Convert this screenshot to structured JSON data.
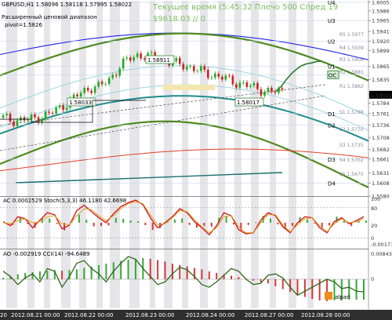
{
  "header": {
    "symbol_line": "GBPUSD,H1  1.58096 1.58118 1.57995 1.58022",
    "line2": "Расширенный ценовой диапазон",
    "line3": "pivot=1.5826",
    "watermark1": "Текущее время (5:45:32 Плечо 500 Спред 19",
    "watermark2": "$9618.03    // 0"
  },
  "chart_data": [
    {
      "type": "line",
      "title": "GBPUSD,H1",
      "ohlc": {
        "open": 1.58096,
        "high": 1.58118,
        "low": 1.57995,
        "close": 1.58022
      },
      "ylim": [
        1.558,
        1.601
      ],
      "y_ticks": [
        "1.6005",
        "1.5986",
        "1.5965",
        "1.5941",
        "1.5920",
        "1.5899",
        "1.5865",
        "1.5835",
        "1.5802",
        "1.5784",
        "1.5761",
        "1.5736",
        "1.5708",
        "1.5682",
        "1.5661",
        "1.5631",
        "1.5608",
        "1.5580"
      ],
      "current_price": "1.58022",
      "x_ticks": [
        "20",
        "2012.08.21 00:00",
        "2012.08.22 00:00",
        "2012.08.23 00:00",
        "2012.08.24 00:00",
        "2012.08.27 00:00",
        "2012.08.28 00:00"
      ],
      "price_labels": [
        "1.58033",
        "1.58911",
        "1.58017"
      ],
      "levels": [
        {
          "name": "U4",
          "value": 1.6005
        },
        {
          "name": "U3",
          "value": 1.5965
        },
        {
          "name": "U2",
          "value": 1.592
        },
        {
          "name": "U1",
          "value": 1.5865
        },
        {
          "name": "OC",
          "value": 1.5846
        },
        {
          "name": "D1",
          "value": 1.5761
        },
        {
          "name": "D2",
          "value": 1.5736
        },
        {
          "name": "D3",
          "value": 1.5661
        },
        {
          "name": "D4",
          "value": 1.5608
        }
      ],
      "minor_levels": [
        "R5 1.5977",
        "R4 1.5939",
        "R3 1.5906",
        "R2 1.5881",
        "R1 1.5862",
        "S1 1.5798",
        "S2 1.5770",
        "S3 1.5735",
        "S4 1.5702",
        "S5 1.5670"
      ],
      "series": [
        {
          "values": [
            1.5752,
            1.5745,
            1.5748,
            1.5749,
            1.5755,
            1.5762,
            1.5775,
            1.579,
            1.5805,
            1.5818,
            1.582,
            1.5835,
            1.5862,
            1.588,
            1.589,
            1.5886,
            1.5882,
            1.5876,
            1.587,
            1.5866,
            1.5858,
            1.585,
            1.5845,
            1.5838,
            1.583,
            1.5825,
            1.5818,
            1.5812,
            1.5808,
            1.581
          ]
        },
        {
          "values": [
            1.581,
            1.582,
            1.5835,
            1.5848,
            1.5858,
            1.5866,
            1.587,
            1.5872,
            1.5875,
            1.5876
          ]
        }
      ],
      "colors": {
        "price_up": "#22aa22",
        "price_down": "#cc2222",
        "ma_green": "#4e8a1e",
        "ma_teal": "#1f8c8c",
        "ma_blue": "#2222ee",
        "ma_red": "#e0402a",
        "forecast": "#2a7a2a"
      }
    },
    {
      "type": "line",
      "title": "AC 0.0002529  Stoch(5,3,3) 46.1180 42.6698",
      "ylim": [
        0,
        100
      ],
      "y_ticks": [
        "100",
        "80",
        "20",
        "0",
        "-0.00171"
      ],
      "ac_value": 0.0002529,
      "series": [
        {
          "name": "Stoch %K",
          "values": [
            52,
            44,
            62,
            58,
            40,
            55,
            70,
            66,
            38,
            45,
            74,
            85,
            72,
            60,
            50,
            68,
            82,
            90,
            95,
            86,
            60,
            40,
            50,
            62,
            78,
            70,
            52,
            40,
            26,
            44,
            70,
            64,
            36,
            28,
            30,
            55,
            70,
            64,
            42,
            30,
            50,
            62,
            60,
            40,
            30,
            52,
            60,
            48,
            54,
            62
          ]
        },
        {
          "name": "Stoch %D",
          "values": [
            50,
            48,
            54,
            58,
            50,
            52,
            62,
            64,
            48,
            46,
            64,
            78,
            76,
            64,
            54,
            64,
            78,
            88,
            92,
            88,
            66,
            46,
            48,
            60,
            74,
            72,
            56,
            42,
            30,
            40,
            62,
            64,
            42,
            30,
            30,
            50,
            66,
            66,
            46,
            32,
            46,
            58,
            60,
            44,
            32,
            48,
            58,
            50,
            52,
            58
          ]
        }
      ]
    },
    {
      "type": "line",
      "title": "AO -0.002919  CCI(14) -94.6489",
      "ylim": [
        -200,
        200
      ],
      "y_ticks": [
        "0.008437",
        "0"
      ],
      "cci_value": -94.6489,
      "ao_value": -0.002919,
      "series": [
        {
          "name": "CCI",
          "values": [
            60,
            20,
            -40,
            10,
            40,
            -20,
            80,
            60,
            -60,
            20,
            120,
            140,
            80,
            40,
            -20,
            60,
            120,
            170,
            150,
            80,
            20,
            -40,
            -20,
            40,
            90,
            70,
            20,
            -40,
            -60,
            -20,
            30,
            80,
            60,
            0,
            -40,
            -30,
            30,
            40,
            10,
            -60,
            -120,
            -90,
            -60,
            -30,
            0,
            -20,
            -70,
            -60,
            -90,
            -95
          ]
        }
      ],
      "ao_bars": [
        0.0002,
        0.0004,
        0.0007,
        0.0009,
        0.001,
        0.0011,
        0.0012,
        0.0013,
        0.0012,
        0.0013,
        0.0014,
        0.0016,
        0.0018,
        0.002,
        0.0022,
        0.0024,
        0.0026,
        0.0028,
        0.0029,
        0.003,
        0.0029,
        0.0027,
        0.0025,
        0.0022,
        0.002,
        0.0018,
        0.0016,
        0.0014,
        0.0011,
        0.0009,
        0.0007,
        0.0005,
        0.0003,
        0.0001,
        -0.0002,
        -0.0004,
        -0.0006,
        -0.001,
        -0.0014,
        -0.0018,
        -0.0022,
        -0.0025,
        -0.0028,
        -0.003,
        -0.0031,
        -0.003,
        -0.003,
        -0.0029,
        -0.0029,
        -0.0029
      ]
    }
  ],
  "logo": "alpari"
}
